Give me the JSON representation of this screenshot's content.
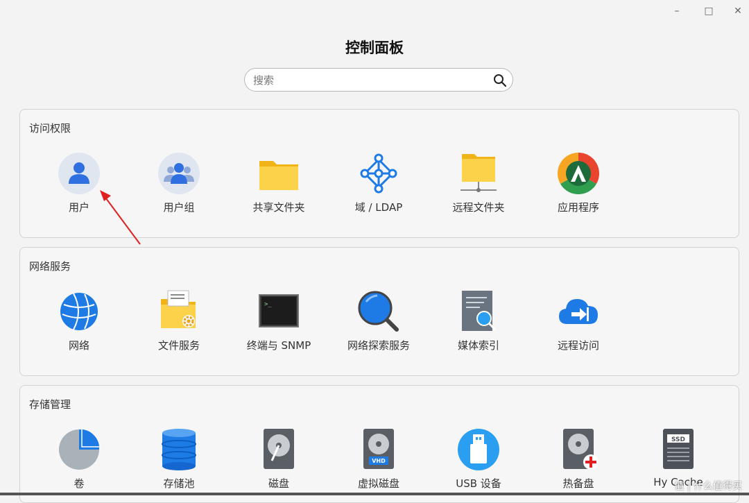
{
  "window": {
    "title": "控制面板",
    "controls": {
      "minimize": "–",
      "maximize": "□",
      "close": "✕"
    }
  },
  "search": {
    "placeholder": "搜索",
    "icon": "search-icon"
  },
  "sections": [
    {
      "title": "访问权限",
      "items": [
        {
          "label": "用户",
          "icon": "user-icon"
        },
        {
          "label": "用户组",
          "icon": "user-group-icon"
        },
        {
          "label": "共享文件夹",
          "icon": "shared-folder-icon"
        },
        {
          "label": "域 / LDAP",
          "icon": "domain-ldap-icon"
        },
        {
          "label": "远程文件夹",
          "icon": "remote-folder-icon"
        },
        {
          "label": "应用程序",
          "icon": "application-icon"
        }
      ]
    },
    {
      "title": "网络服务",
      "items": [
        {
          "label": "网络",
          "icon": "globe-icon"
        },
        {
          "label": "文件服务",
          "icon": "file-service-icon"
        },
        {
          "label": "终端与 SNMP",
          "icon": "terminal-icon"
        },
        {
          "label": "网络探索服务",
          "icon": "network-discovery-icon"
        },
        {
          "label": "媒体索引",
          "icon": "media-index-icon"
        },
        {
          "label": "远程访问",
          "icon": "remote-access-icon"
        }
      ]
    },
    {
      "title": "存储管理",
      "items": [
        {
          "label": "卷",
          "icon": "volume-icon"
        },
        {
          "label": "存储池",
          "icon": "storage-pool-icon"
        },
        {
          "label": "磁盘",
          "icon": "disk-icon"
        },
        {
          "label": "虚拟磁盘",
          "icon": "virtual-disk-icon"
        },
        {
          "label": "USB 设备",
          "icon": "usb-icon"
        },
        {
          "label": "热备盘",
          "icon": "hot-spare-icon"
        },
        {
          "label": "Hy Cache",
          "icon": "ssd-cache-icon"
        }
      ]
    }
  ],
  "watermark": "值 | 什么值得买",
  "colors": {
    "accent_blue": "#1e7be6",
    "folder_yellow": "#f9c72a",
    "annotation_red": "#e02020"
  }
}
